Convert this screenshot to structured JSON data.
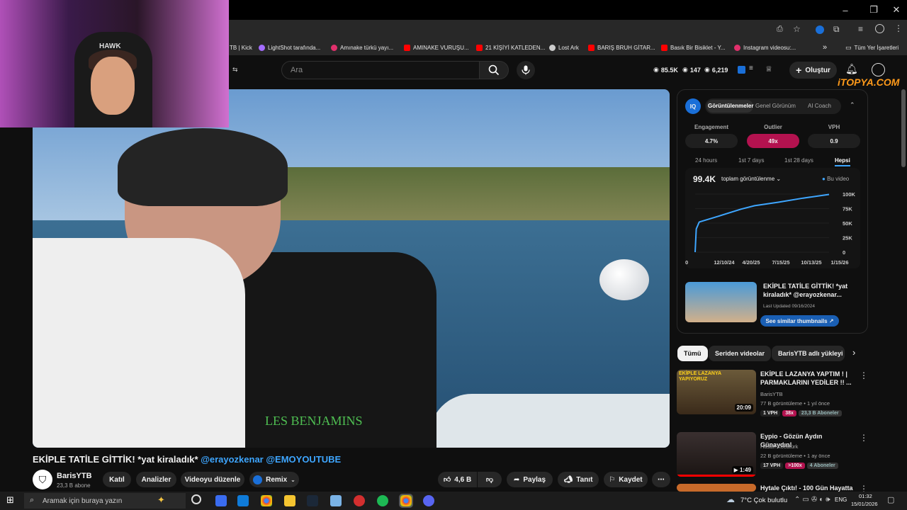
{
  "browser": {
    "bookmarks": [
      {
        "label": "TB | Kick",
        "color": "#53fc18"
      },
      {
        "label": "LightShot tarafında...",
        "color": "#a46cff"
      },
      {
        "label": "Amınake türkü yayı...",
        "color": "#e1306c"
      },
      {
        "label": "AMINAKE VURUŞU...",
        "color": "#ff0000"
      },
      {
        "label": "21 KİŞİYİ KATLEDEN...",
        "color": "#ff0000"
      },
      {
        "label": "Lost Ark",
        "color": "#cccccc"
      },
      {
        "label": "BARIŞ BRUH GİTAR...",
        "color": "#ff0000"
      },
      {
        "label": "Basık Bir Bisiklet - Y...",
        "color": "#ff0000"
      },
      {
        "label": "Instagram videosu:...",
        "color": "#e1306c"
      }
    ],
    "bookmarks_more": "»",
    "all_bookmarks": "Tüm Yer İşaretleri"
  },
  "header": {
    "search_placeholder": "Ara",
    "stats": [
      "85.5K",
      "147",
      "6,219"
    ],
    "create_label": "Oluştur",
    "watermark": "iTOPYA.COM"
  },
  "webcam": {
    "chair_brand": "HAWK"
  },
  "video": {
    "shirt_logo": "LES BENJAMINS",
    "title_main": "EKİPLE TATİLE GİTTİK! *yat kiraladık*",
    "title_tags": "@erayozkenar @EMOYOUTUBE",
    "channel": "BarisYTB",
    "subscribers": "23,3 B abone",
    "buttons": {
      "join": "Katıl",
      "analytics": "Analizler",
      "edit": "Videoyu düzenle",
      "remix": "Remix",
      "likes": "4,6 B",
      "share": "Paylaş",
      "promote": "Tanıt",
      "save": "Kaydet"
    }
  },
  "vidiq": {
    "logo": "IQ",
    "tabs": [
      "Görüntülenmeler",
      "Genel Görünüm",
      "AI Coach"
    ],
    "metrics": [
      {
        "label": "Engagement",
        "value": "4.7%"
      },
      {
        "label": "Outlier",
        "value": "49x"
      },
      {
        "label": "VPH",
        "value": "0.9"
      }
    ],
    "ranges": [
      "24 hours",
      "1st 7 days",
      "1st 28 days",
      "Hepsi"
    ],
    "total": "99.4K",
    "metric_select": "toplam görüntülenme",
    "legend": "Bu video",
    "similar": {
      "title": "EKİPLE TATİLE GİTTİK! *yat kiraladık* @erayozkenar...",
      "updated": "Last Updated 09/16/2024",
      "button": "See similar thumbnails"
    }
  },
  "chart_data": {
    "type": "line",
    "x": [
      "2024-09-16",
      "2024-09-20",
      "2024-10-01",
      "2024-12-10",
      "2025-03-01",
      "2025-04-20",
      "2025-07-15",
      "2025-10-13",
      "2026-01-15"
    ],
    "values": [
      0,
      40000,
      52000,
      62000,
      74000,
      80000,
      86000,
      93000,
      99400
    ],
    "xticks": [
      "0",
      "12/10/24",
      "4/20/25",
      "7/15/25",
      "10/13/25",
      "1/15/26"
    ],
    "yticks": [
      "0",
      "25K",
      "50K",
      "75K",
      "100K"
    ],
    "ylim": [
      0,
      100000
    ],
    "color": "#3ea6ff",
    "series": [
      {
        "name": "Bu video"
      }
    ]
  },
  "chips": [
    "Tümü",
    "Seriden videolar",
    "BarisYTB adlı yükleyi"
  ],
  "related": [
    {
      "title": "EKİPLE LAZANYA YAPTIM ! | PARMAKLARINI YEDİLER !! ...",
      "channel": "BarisYTB",
      "meta": "77 B görüntüleme • 1 yıl önce",
      "vph": "1 VPH",
      "outlier": "38x",
      "subs": "23,3 B Aboneler",
      "duration": "20:09",
      "thumb_text": "EKİPLE LAZANYA YAPIYORUZ"
    },
    {
      "title": "Eypio - Gözün Aydın Günaydın!",
      "channel": "Hasan Kocatürk",
      "meta": "22 B görüntüleme • 1 ay önce",
      "vph": "17 VPH",
      "outlier": ">100x",
      "subs": "4 Aboneler",
      "duration": "1:49"
    },
    {
      "title": "Hytale Çıktı! - 100 Gün Hayatta",
      "channel": "",
      "meta": "",
      "duration": ""
    }
  ],
  "taskbar": {
    "search": "Aramak için buraya yazın",
    "weather": "7°C  Çok bulutlu",
    "lang": "ENG",
    "time": "01:32",
    "date": "15/01/2026"
  }
}
